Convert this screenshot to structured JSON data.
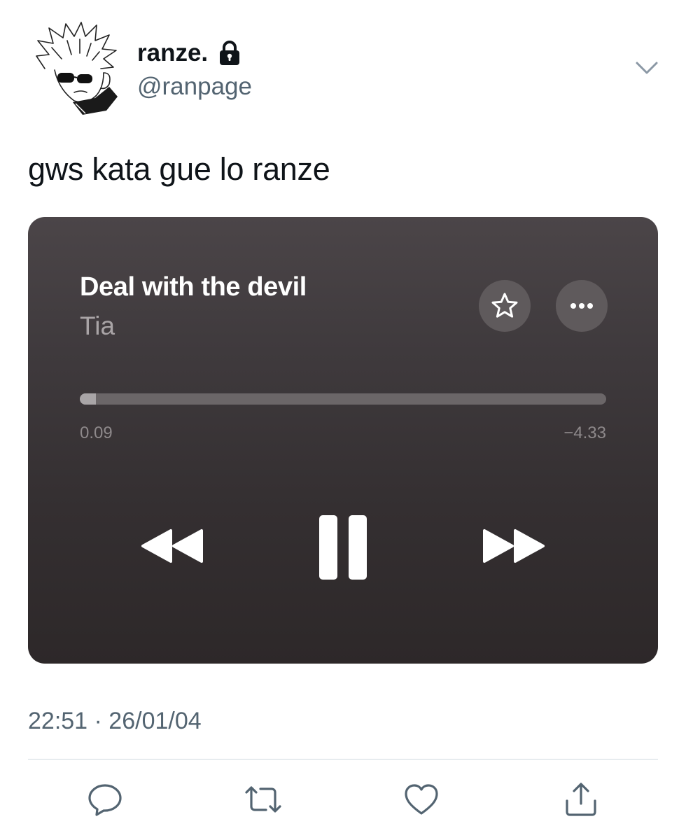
{
  "user": {
    "display_name": "ranze.",
    "handle": "@ranpage",
    "protected_icon": "lock-icon",
    "avatar_icon": "manga-character-avatar"
  },
  "tweet": {
    "text": "gws kata gue lo ranze",
    "timestamp": "22:51 · 26/01/04"
  },
  "player": {
    "song_title": "Deal with the devil",
    "artist": "Tia",
    "progress": 0.03,
    "time_elapsed": "0.09",
    "time_remaining": "−4.33",
    "state": "playing",
    "icons": [
      "star-icon",
      "ellipsis-icon",
      "rewind-icon",
      "pause-icon",
      "fast-forward-icon"
    ]
  },
  "actions": {
    "icons": [
      "reply-icon",
      "retweet-icon",
      "like-icon",
      "share-icon"
    ]
  },
  "colors": {
    "text_primary": "#0f1419",
    "text_secondary": "#536471",
    "card_background": "#3a3537",
    "divider": "#cfd9de"
  }
}
